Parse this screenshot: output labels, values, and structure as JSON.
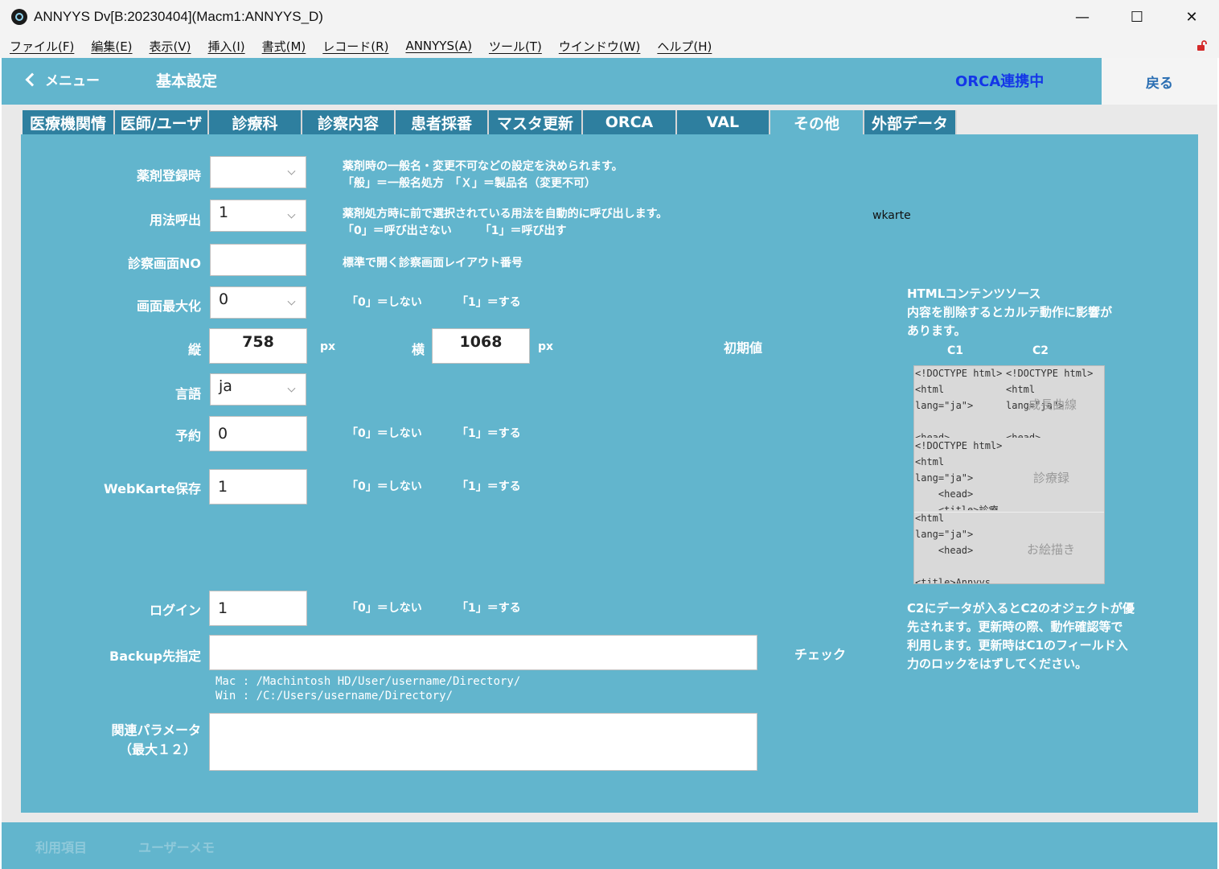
{
  "window": {
    "title": "ANNYYS Dv[B:20230404](Macm1:ANNYYS_D)",
    "controls": {
      "minimize": "—",
      "maximize": "☐",
      "close": "✕"
    }
  },
  "menubar": [
    "ファイル(F)",
    "編集(E)",
    "表示(V)",
    "挿入(I)",
    "書式(M)",
    "レコード(R)",
    "ANNYYS(A)",
    "ツール(T)",
    "ウインドウ(W)",
    "ヘルプ(H)"
  ],
  "header": {
    "menu_label": "メニュー",
    "title": "基本設定",
    "orca_status": "ORCA連携中",
    "back_label": "戻る"
  },
  "tabs": [
    {
      "label": "医療機関情",
      "active": false
    },
    {
      "label": "医師/ユーザ",
      "active": false
    },
    {
      "label": "診療科",
      "active": false
    },
    {
      "label": "診察内容",
      "active": false
    },
    {
      "label": "患者採番",
      "active": false
    },
    {
      "label": "マスタ更新",
      "active": false
    },
    {
      "label": "ORCA",
      "active": false
    },
    {
      "label": "VAL",
      "active": false
    },
    {
      "label": "その他",
      "active": true
    },
    {
      "label": "外部データ",
      "active": false
    }
  ],
  "form": {
    "drug_reg": {
      "label": "薬剤登録時",
      "value": "",
      "note1": "薬剤時の一般名・変更不可などの設定を決められます。",
      "note2": "「般」＝一般名処方　「Ｘ」＝製品名（変更不可）"
    },
    "usage_call": {
      "label": "用法呼出",
      "value": "1",
      "note1": "薬剤処方時に前で選択されている用法を自動的に呼び出します。",
      "note2": "「0」＝呼び出さない　　　「1」＝呼び出す"
    },
    "exam_screen_no": {
      "label": "診察画面NO",
      "value": "",
      "note": "標準で開く診察画面レイアウト番号"
    },
    "maximize": {
      "label": "画面最大化",
      "value": "0",
      "note_0": "「0」＝しない",
      "note_1": "「1」＝する"
    },
    "size": {
      "height_label": "縦",
      "height_value": "758",
      "height_unit": "px",
      "width_label": "横",
      "width_value": "1068",
      "width_unit": "px",
      "default_label": "初期値"
    },
    "language": {
      "label": "言語",
      "value": "ja"
    },
    "reservation": {
      "label": "予約",
      "value": "0",
      "note_0": "「0」＝しない",
      "note_1": "「1」＝する"
    },
    "webkarte_save": {
      "label": "WebKarte保存",
      "value": "1",
      "note_0": "「0」＝しない",
      "note_1": "「1」＝する"
    },
    "login": {
      "label": "ログイン",
      "value": "1",
      "note_0": "「0」＝しない",
      "note_1": "「1」＝する"
    },
    "backup": {
      "label": "Backup先指定",
      "value": "",
      "check_label": "チェック",
      "hint_mac": "Mac : /Machintosh HD/User/username/Directory/",
      "hint_win": "Win : /C:/Users/username/Directory/"
    },
    "related_params": {
      "label1": "関連パラメータ",
      "label2": "（最大１２）",
      "value": ""
    }
  },
  "side": {
    "wkarte": "wkarte",
    "html_title1": "HTMLコンテンツソース",
    "html_title2": "内容を削除するとカルテ動作に影響が",
    "html_title3": "あります。",
    "col1": "C1",
    "col2": "C2",
    "row1_c1": "<!DOCTYPE html>\n<html\nlang=\"ja\">\n\n<head>",
    "row1_c2": "<!DOCTYPE html>\n<html\nlang=\"ja\">\n\n<head>",
    "row1_overlay": "成長曲線",
    "row2_c1": "<!DOCTYPE html>\n<html\nlang=\"ja\">\n    <head>\n    <title>診療",
    "row2_overlay": "診療録",
    "row3_c1": "<html\nlang=\"ja\">\n    <head>\n\n<title>Annyys",
    "row3_overlay": "お絵描き",
    "footnote1": "C2にデータが入るとC2のオジェクトが優",
    "footnote2": "先されます。更新時の際、動作確認等で",
    "footnote3": "利用します。更新時はC1のフィールド入",
    "footnote4": "力のロックをはずしてください。"
  },
  "footer": {
    "item1": "利用項目",
    "item2": "ユーザーメモ"
  }
}
